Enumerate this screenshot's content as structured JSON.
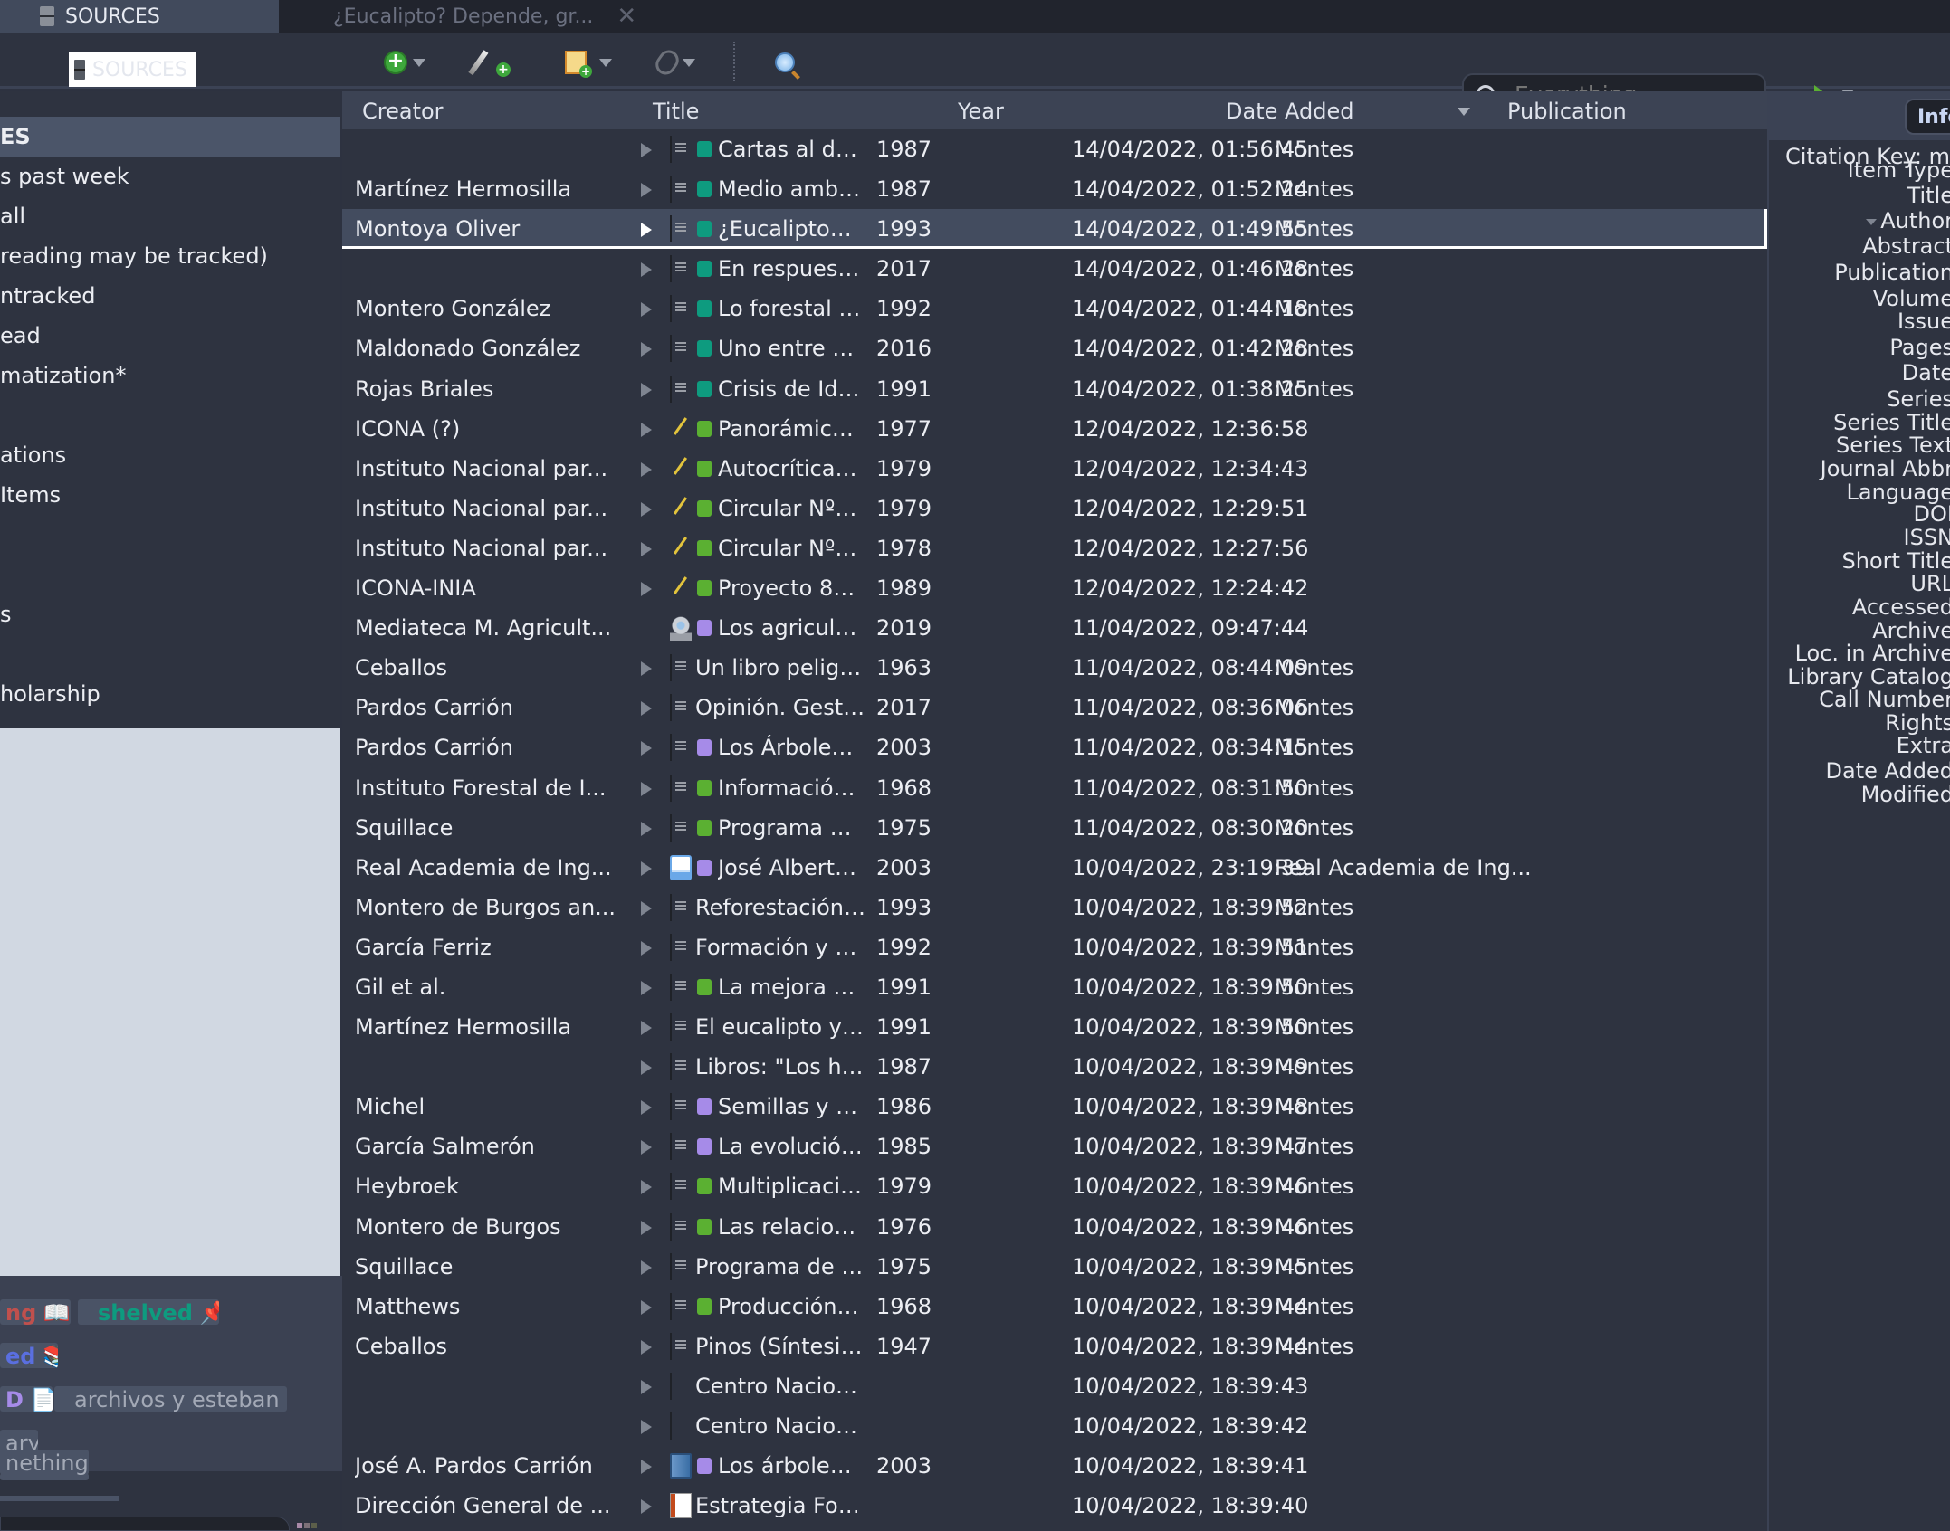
{
  "tabs": {
    "library_tab": "SOURCES",
    "doc_tab": "¿Eucalipto? Depende, gr..."
  },
  "toolbar": {
    "library_label": "SOURCES",
    "search_placeholder": "Everything",
    "search_mode": "Everything"
  },
  "sidebar": {
    "items": [
      {
        "label": "ES",
        "selected": true
      },
      {
        "label": "s past week"
      },
      {
        "label": " all"
      },
      {
        "label": "reading may be tracked)"
      },
      {
        "label": "ntracked"
      },
      {
        "label": "ead"
      },
      {
        "label": "matization*"
      },
      {
        "label": ""
      },
      {
        "label": "ations"
      },
      {
        "label": "Items"
      },
      {
        "label": ""
      },
      {
        "label": ""
      },
      {
        "label": "s"
      },
      {
        "label": ""
      },
      {
        "label": "holarship"
      }
    ]
  },
  "tags": [
    {
      "label": "ng",
      "emoji": "📖",
      "color": "#c0504d"
    },
    {
      "label": "shelved",
      "emoji": "📌",
      "color": "#0e9b7f"
    },
    {
      "label": "ed",
      "emoji": "📚",
      "color": "#5a6fe0"
    },
    {
      "label": "D",
      "emoji": "📄",
      "color": "#a68be8"
    },
    {
      "label": "archivos y esteban",
      "color": "#a3a9b6"
    },
    {
      "label": "ary",
      "color": "#a3a9b6"
    },
    {
      "label": "nething",
      "color": "#a3a9b6"
    }
  ],
  "columns": {
    "creator": "Creator",
    "title": "Title",
    "year": "Year",
    "date_added": "Date Added",
    "publication": "Publication"
  },
  "colors": {
    "tag_teal": "#0e9b7f",
    "tag_green": "#5bb032",
    "tag_purple": "#a68be8",
    "selection": "#434c5f"
  },
  "rows": [
    {
      "creator": "",
      "icon": "doc",
      "tag": "teal",
      "title": "Cartas al director",
      "year": "1987",
      "date": "14/04/2022, 01:56:45",
      "pub": "Montes"
    },
    {
      "creator": "Martínez Hermosilla",
      "icon": "doc",
      "tag": "teal",
      "title": "Medio ambient...",
      "year": "1987",
      "date": "14/04/2022, 01:52:24",
      "pub": "Montes"
    },
    {
      "creator": "Montoya Oliver",
      "icon": "doc",
      "tag": "teal",
      "title": "¿Eucalipto? Dep...",
      "year": "1993",
      "date": "14/04/2022, 01:49:55",
      "pub": "Montes",
      "selected": true
    },
    {
      "creator": "",
      "icon": "doc",
      "tag": "teal",
      "title": "En respuesta a ...",
      "year": "2017",
      "date": "14/04/2022, 01:46:28",
      "pub": "Montes"
    },
    {
      "creator": "Montero González",
      "icon": "doc",
      "tag": "teal",
      "title": "Lo forestal no e...",
      "year": "1992",
      "date": "14/04/2022, 01:44:18",
      "pub": "Montes"
    },
    {
      "creator": "Maldonado González",
      "icon": "doc",
      "tag": "teal",
      "title": "Uno entre siete ...",
      "year": "2016",
      "date": "14/04/2022, 01:42:28",
      "pub": "Montes"
    },
    {
      "creator": "Rojas Briales",
      "icon": "doc",
      "tag": "teal",
      "title": "Crisis de Identi...",
      "year": "1991",
      "date": "14/04/2022, 01:38:25",
      "pub": "Montes"
    },
    {
      "creator": "ICONA (?)",
      "icon": "manuscript",
      "tag": "green",
      "title": "Panorámica crit...",
      "year": "1977",
      "date": "12/04/2022, 12:36:58",
      "pub": ""
    },
    {
      "creator": "Instituto Nacional par...",
      "icon": "manuscript",
      "tag": "green",
      "title": "Autocrítica del I...",
      "year": "1979",
      "date": "12/04/2022, 12:34:43",
      "pub": ""
    },
    {
      "creator": "Instituto Nacional par...",
      "icon": "manuscript",
      "tag": "green",
      "title": "Circular Nº4/19...",
      "year": "1979",
      "date": "12/04/2022, 12:29:51",
      "pub": ""
    },
    {
      "creator": "Instituto Nacional par...",
      "icon": "manuscript",
      "tag": "green",
      "title": "Circular Nº11/1...",
      "year": "1978",
      "date": "12/04/2022, 12:27:56",
      "pub": ""
    },
    {
      "creator": "ICONA-INIA",
      "icon": "manuscript",
      "tag": "green",
      "title": "Proyecto 8600 \"...",
      "year": "1989",
      "date": "12/04/2022, 12:24:42",
      "pub": ""
    },
    {
      "creator": "Mediateca M. Agricult...",
      "icon": "video",
      "tag": "purple",
      "title": "Los agricultores...",
      "year": "2019",
      "date": "11/04/2022, 09:47:44",
      "pub": "",
      "no_twisty": true
    },
    {
      "creator": "Ceballos",
      "icon": "doc",
      "tag": "",
      "title": "Un libro peligroso",
      "year": "1963",
      "date": "11/04/2022, 08:44:09",
      "pub": "Montes"
    },
    {
      "creator": "Pardos Carrión",
      "icon": "doc",
      "tag": "",
      "title": "Opinión. Gestión ...",
      "year": "2017",
      "date": "11/04/2022, 08:36:06",
      "pub": "Montes"
    },
    {
      "creator": "Pardos Carrión",
      "icon": "doc",
      "tag": "purple",
      "title": "Los Árboles, pr...",
      "year": "2003",
      "date": "11/04/2022, 08:34:15",
      "pub": "Montes"
    },
    {
      "creator": "Instituto Forestal de I...",
      "icon": "doc",
      "tag": "green",
      "title": "Información del...",
      "year": "1968",
      "date": "11/04/2022, 08:31:50",
      "pub": "Montes"
    },
    {
      "creator": "Squillace",
      "icon": "doc",
      "tag": "green",
      "title": "Programa de de...",
      "year": "1975",
      "date": "11/04/2022, 08:30:20",
      "pub": "Montes"
    },
    {
      "creator": "Real Academia de Ing...",
      "icon": "webpage",
      "tag": "purple",
      "title": "José Alberto Par...",
      "year": "2003",
      "date": "10/04/2022, 23:19:39",
      "pub": "Real Academia de Ing..."
    },
    {
      "creator": "Montero de Burgos an...",
      "icon": "doc",
      "tag": "",
      "title": "Reforestación y Bi...",
      "year": "1993",
      "date": "10/04/2022, 18:39:52",
      "pub": "Montes"
    },
    {
      "creator": "García Ferriz",
      "icon": "doc",
      "tag": "",
      "title": "Formación y desa...",
      "year": "1992",
      "date": "10/04/2022, 18:39:51",
      "pub": "Montes"
    },
    {
      "creator": "Gil et al.",
      "icon": "doc",
      "tag": "green",
      "title": "La mejora gené...",
      "year": "1991",
      "date": "10/04/2022, 18:39:50",
      "pub": "Montes"
    },
    {
      "creator": "Martínez Hermosilla",
      "icon": "doc",
      "tag": "",
      "title": "El eucalipto y la p...",
      "year": "1991",
      "date": "10/04/2022, 18:39:50",
      "pub": "Montes"
    },
    {
      "creator": "",
      "icon": "doc",
      "tag": "",
      "title": "Libros: \"Los huert...",
      "year": "1987",
      "date": "10/04/2022, 18:39:49",
      "pub": "Montes"
    },
    {
      "creator": "Michel",
      "icon": "doc",
      "tag": "purple",
      "title": "Semillas y Plant...",
      "year": "1986",
      "date": "10/04/2022, 18:39:48",
      "pub": "Montes"
    },
    {
      "creator": "García Salmerón",
      "icon": "doc",
      "tag": "purple",
      "title": "La evolución cli...",
      "year": "1985",
      "date": "10/04/2022, 18:39:47",
      "pub": "Montes"
    },
    {
      "creator": "Heybroek",
      "icon": "doc",
      "tag": "green",
      "title": "Multiplicación y...",
      "year": "1979",
      "date": "10/04/2022, 18:39:46",
      "pub": "Montes"
    },
    {
      "creator": "Montero de Burgos",
      "icon": "doc",
      "tag": "green",
      "title": "Las relaciones c...",
      "year": "1976",
      "date": "10/04/2022, 18:39:46",
      "pub": "Montes"
    },
    {
      "creator": "Squillace",
      "icon": "doc",
      "tag": "",
      "title": "Programa de desa...",
      "year": "1975",
      "date": "10/04/2022, 18:39:45",
      "pub": "Montes"
    },
    {
      "creator": "Matthews",
      "icon": "doc",
      "tag": "green",
      "title": "Producción y ce...",
      "year": "1968",
      "date": "10/04/2022, 18:39:44",
      "pub": "Montes"
    },
    {
      "creator": "Ceballos",
      "icon": "doc",
      "tag": "",
      "title": "Pinos (Síntesis bo...",
      "year": "1947",
      "date": "10/04/2022, 18:39:44",
      "pub": "Montes"
    },
    {
      "creator": "",
      "icon": "doc-blank",
      "tag": "",
      "title": "Centro Nacional ...",
      "year": "",
      "date": "10/04/2022, 18:39:43",
      "pub": ""
    },
    {
      "creator": "",
      "icon": "doc-blank",
      "tag": "",
      "title": "Centro Nacional ...",
      "year": "",
      "date": "10/04/2022, 18:39:42",
      "pub": ""
    },
    {
      "creator": "José A. Pardos Carrión",
      "icon": "book",
      "tag": "purple",
      "title": "Los árboles, pr...",
      "year": "2003",
      "date": "10/04/2022, 18:39:41",
      "pub": ""
    },
    {
      "creator": "Dirección General de ...",
      "icon": "report",
      "tag": "",
      "title": "Estrategia Foresta...",
      "year": "",
      "date": "10/04/2022, 18:39:40",
      "pub": ""
    }
  ],
  "info_pane": {
    "tab_label": "Info",
    "citation_key": "Citation Key: m",
    "fields": [
      "Item Type",
      "Title",
      "Author",
      "Abstract",
      "Publication",
      "Volume",
      "Issue",
      "Pages",
      "Date",
      "Series",
      "Series Title",
      "Series Text",
      "Journal Abbr",
      "Language",
      "DOI",
      "ISSN",
      "Short Title",
      "URL",
      "Accessed",
      "Archive",
      "Loc. in Archive",
      "Library Catalog",
      "Call Number",
      "Rights",
      "Extra",
      "Date Added",
      "Modified"
    ]
  }
}
